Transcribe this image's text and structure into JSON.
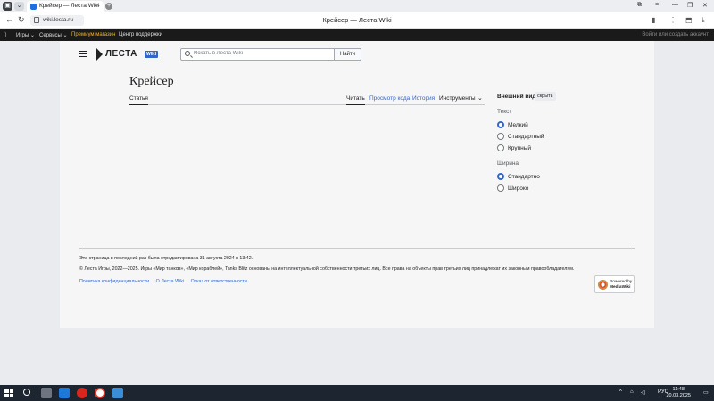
{
  "browser": {
    "tab_title": "Крейсер — Леста Wiki",
    "tab_close": "×",
    "new_tab": "+",
    "url": "wiki.lesta.ru",
    "window_title": "Крейсер — Леста Wiki",
    "back": "←",
    "reload": "↻",
    "controls": [
      "—",
      "❐",
      "✕"
    ]
  },
  "topnav": {
    "items": [
      "Игры ⌄",
      "Сервисы ⌄",
      "Премиум магазин",
      "Центр поддержки"
    ],
    "auth": "Войти или создать аккаунт"
  },
  "header": {
    "logo_text": "ЛЕСТА",
    "logo_badge": "WIKI",
    "search_placeholder": "Искать в Леста Wiki",
    "search_button": "Найти"
  },
  "article": {
    "title": "Крейсер",
    "tab_article": "Статья",
    "tab_read": "Читать",
    "tab_view_source": "Просмотр кода",
    "tab_history": "История",
    "tab_tools": "Инструменты"
  },
  "appearance": {
    "title": "Внешний вид",
    "hide": "скрыть",
    "text_label": "Текст",
    "text_options": [
      "Мелкий",
      "Стандартный",
      "Крупный"
    ],
    "text_selected": "Мелкий",
    "width_label": "Ширина",
    "width_options": [
      "Стандартно",
      "Широко"
    ],
    "width_selected": "Стандартно"
  },
  "footer": {
    "last_edited": "Эта страница в последний раз была отредактирована 31 августа 2024 в 13:42.",
    "copyright": "© Леста Игры, 2022—2025. Игры «Мир танков», «Мир кораблей», Tanks Blitz основаны на интеллектуальной собственности третьих лиц. Все права на объекты прав третьих лиц принадлежат их законным правообладателям.",
    "links": [
      "Политика конфиденциальности",
      "О Леста Wiki",
      "Отказ от ответственности"
    ],
    "powered_1": "Powered by",
    "powered_2": "MediaWiki"
  },
  "taskbar": {
    "lang": "РУС",
    "time": "11:48",
    "date": "20.03.2025"
  },
  "colors": {
    "link": "#3366cc",
    "premium": "#f3b31b",
    "taskbar": "#1c2530"
  }
}
